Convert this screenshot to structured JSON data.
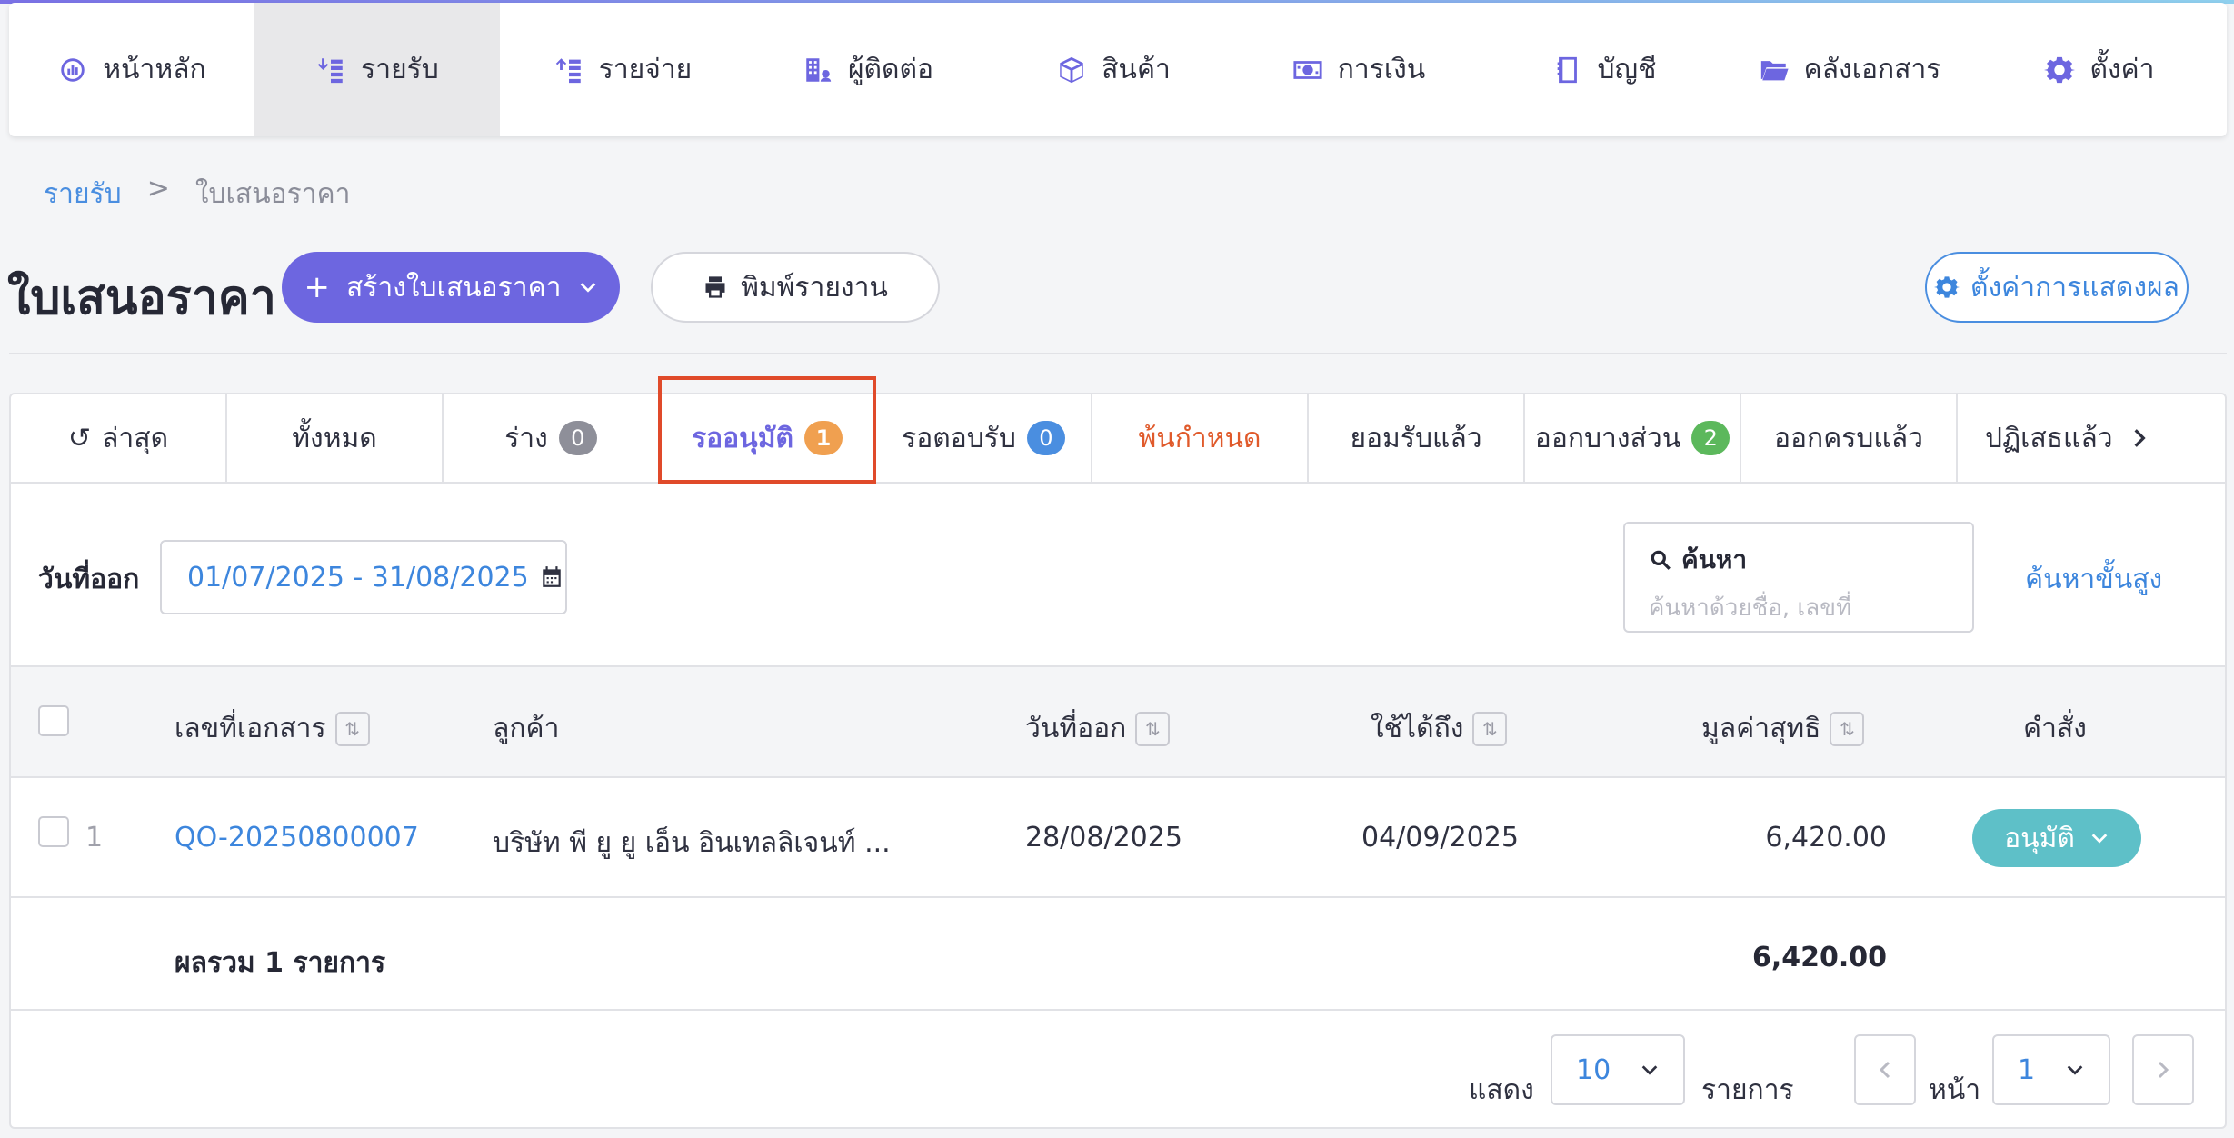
{
  "nav": [
    {
      "label": "หน้าหลัก",
      "icon": "dashboard-icon",
      "active": false
    },
    {
      "label": "รายรับ",
      "icon": "income-icon",
      "active": true
    },
    {
      "label": "รายจ่าย",
      "icon": "expense-icon",
      "active": false
    },
    {
      "label": "ผู้ติดต่อ",
      "icon": "contacts-icon",
      "active": false
    },
    {
      "label": "สินค้า",
      "icon": "box-icon",
      "active": false
    },
    {
      "label": "การเงิน",
      "icon": "money-icon",
      "active": false
    },
    {
      "label": "บัญชี",
      "icon": "ledger-icon",
      "active": false
    },
    {
      "label": "คลังเอกสาร",
      "icon": "folder-icon",
      "active": false
    },
    {
      "label": "ตั้งค่า",
      "icon": "gear-icon",
      "active": false
    }
  ],
  "breadcrumb": {
    "parent": "รายรับ",
    "sep": ">",
    "current": "ใบเสนอราคา"
  },
  "header": {
    "title": "ใบเสนอราคา",
    "create_label": "สร้างใบเสนอราคา",
    "print_label": "พิมพ์รายงาน",
    "settings_label": "ตั้งค่าการแสดงผล"
  },
  "tabs": [
    {
      "label": "ล่าสุด",
      "badge": null
    },
    {
      "label": "ทั้งหมด",
      "badge": null
    },
    {
      "label": "ร่าง",
      "badge": "0",
      "badge_color": "#8e8f99"
    },
    {
      "label": "รออนุมัติ",
      "badge": "1",
      "badge_color": "#f0a050",
      "active": true
    },
    {
      "label": "รอตอบรับ",
      "badge": "0",
      "badge_color": "#4a8ee0"
    },
    {
      "label": "พ้นกำหนด",
      "badge": null,
      "overdue": true
    },
    {
      "label": "ยอมรับแล้ว",
      "badge": null
    },
    {
      "label": "ออกบางส่วน",
      "badge": "2",
      "badge_color": "#5cb85c"
    },
    {
      "label": "ออกครบแล้ว",
      "badge": null
    },
    {
      "label": "ปฏิเสธแล้ว",
      "badge": null
    }
  ],
  "filters": {
    "date_label": "วันที่ออก",
    "date_value": "01/07/2025 - 31/08/2025",
    "search_label": "ค้นหา",
    "search_placeholder": "ค้นหาด้วยชื่อ, เลขที่",
    "advanced_search": "ค้นหาขั้นสูง"
  },
  "table": {
    "headers": {
      "doc_no": "เลขที่เอกสาร",
      "customer": "ลูกค้า",
      "issue_date": "วันที่ออก",
      "valid_until": "ใช้ได้ถึง",
      "net_value": "มูลค่าสุทธิ",
      "action": "คำสั่ง"
    },
    "rows": [
      {
        "index": "1",
        "doc_no": "QO-20250800007",
        "customer": "บริษัท พี ยู ยู เอ็น อินเทลลิเจนท์ ...",
        "issue_date": "28/08/2025",
        "valid_until": "04/09/2025",
        "net_value": "6,420.00",
        "action": "อนุมัติ"
      }
    ],
    "footer": {
      "label": "ผลรวม 1 รายการ",
      "total": "6,420.00"
    }
  },
  "pagination": {
    "show_label": "แสดง",
    "page_size": "10",
    "items_label": "รายการ",
    "page_label": "หน้า",
    "page": "1"
  }
}
